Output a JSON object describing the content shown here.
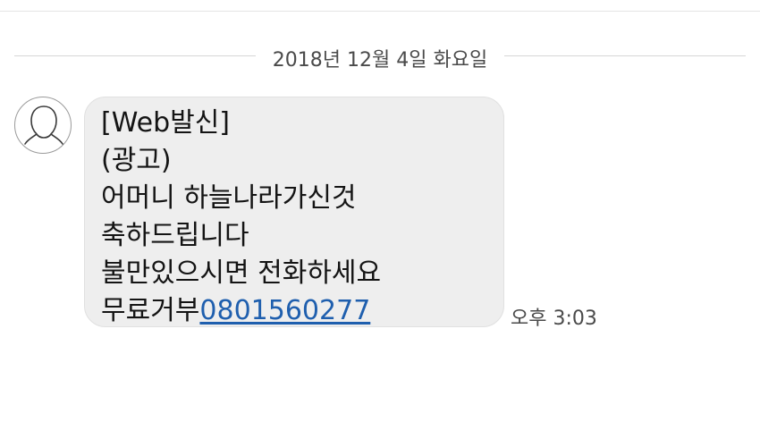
{
  "date_header": "2018년 12월 4일 화요일",
  "contact": {
    "avatar_icon": "person-silhouette-icon"
  },
  "message": {
    "lines": [
      "[Web발신]",
      "(광고)",
      "어머니 하늘나라가신것",
      "축하드립니다",
      "불만있으시면 전화하세요"
    ],
    "last_line_prefix": "무료거부",
    "phone_number": "0801560277",
    "timestamp": "오후 3:03"
  },
  "colors": {
    "bubble": "#eeeeee",
    "link": "#1f5fae",
    "text": "#141414",
    "meta_text": "#4a4a4a"
  }
}
